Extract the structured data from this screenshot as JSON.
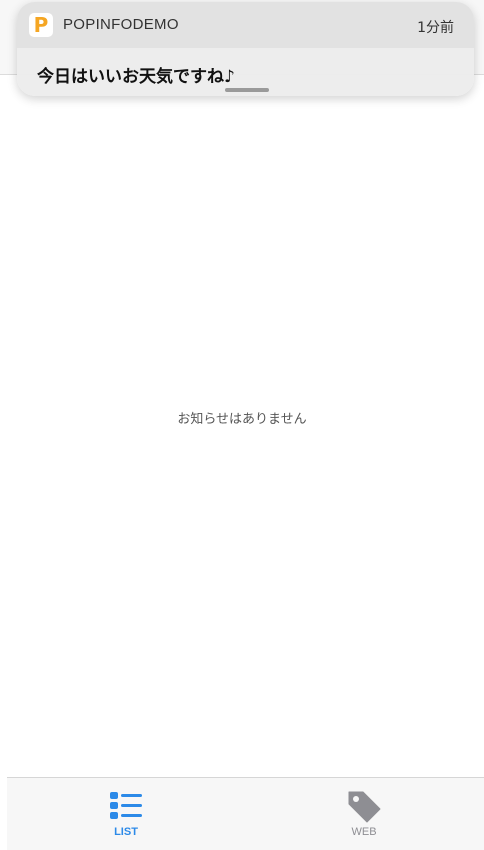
{
  "notification": {
    "app_name": "POPINFODEMO",
    "app_icon_letter": "P",
    "time": "1分前",
    "message": "今日はいいお天気ですね♪"
  },
  "main": {
    "empty_message": "お知らせはありません"
  },
  "tab_bar": {
    "tabs": [
      {
        "label": "LIST",
        "icon": "list-icon",
        "selected": true
      },
      {
        "label": "WEB",
        "icon": "tag-icon",
        "selected": false
      }
    ]
  },
  "colors": {
    "accent": "#2c8ae8",
    "inactive": "#8e8e93",
    "app_icon": "#f5a623"
  }
}
